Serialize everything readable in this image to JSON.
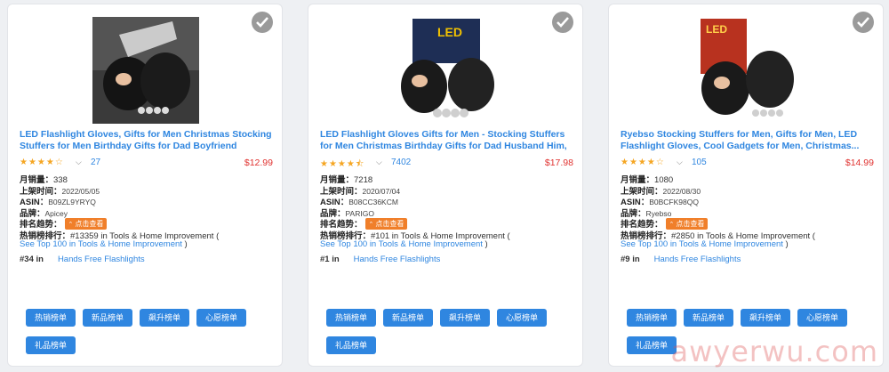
{
  "products": [
    {
      "title": "LED Flashlight Gloves, Gifts for Men Christmas Stocking Stuffers for Men Birthday Gifts for Dad Boyfriend Husban...",
      "stars": "★★★★☆",
      "rating_value": 3.8,
      "review_count": "27",
      "price": "$12.99",
      "monthly_sales_label": "月销量：",
      "monthly_sales": "338",
      "listed_label": "上架时间：",
      "listed_date": "2022/05/05",
      "asin_label": "ASIN：",
      "asin": "B09ZL9YRYQ",
      "brand_label": "品牌：",
      "brand": "Apicey",
      "trend_label": "排名趋势：",
      "trend_button": "点击查看",
      "rank_label": "热销榜排行：",
      "rank_text": "#13359 in   Tools & Home Improvement (",
      "top100_prefix": "See Top 100 in",
      "top100_category": "Tools & Home Improvement",
      "top100_suffix": ")",
      "sub_rank": "#34  in",
      "sub_category": "Hands Free Flashlights"
    },
    {
      "title": "LED Flashlight Gloves Gifts for Men - Stocking Stuffers for Men Christmas Birthday Gifts for Dad Husband Him, Car...",
      "stars": "★★★★⯪",
      "rating_value": 4.5,
      "review_count": "7402",
      "price": "$17.98",
      "monthly_sales_label": "月销量：",
      "monthly_sales": "7218",
      "listed_label": "上架时间：",
      "listed_date": "2020/07/04",
      "asin_label": "ASIN：",
      "asin": "B08CC36KCM",
      "brand_label": "品牌：",
      "brand": "PARIGO",
      "trend_label": "排名趋势：",
      "trend_button": "点击查看",
      "rank_label": "热销榜排行：",
      "rank_text": "#101 in   Tools & Home Improvement (",
      "top100_prefix": "See Top 100 in",
      "top100_category": "Tools & Home Improvement",
      "top100_suffix": ")",
      "sub_rank": "#1  in",
      "sub_category": "Hands Free Flashlights"
    },
    {
      "title": "Ryebso Stocking Stuffers for Men, Gifts for Men, LED Flashlight Gloves, Cool Gadgets for Men, Christmas...",
      "stars": "★★★★☆",
      "rating_value": 4.0,
      "review_count": "105",
      "price": "$14.99",
      "monthly_sales_label": "月销量：",
      "monthly_sales": "1080",
      "listed_label": "上架时间：",
      "listed_date": "2022/08/30",
      "asin_label": "ASIN：",
      "asin": "B0BCFK98QQ",
      "brand_label": "品牌：",
      "brand": "Ryebso",
      "trend_label": "排名趋势：",
      "trend_button": "点击查看",
      "rank_label": "热销榜排行：",
      "rank_text": "#2850 in   Tools & Home Improvement (",
      "top100_prefix": "See Top 100 in",
      "top100_category": "Tools & Home Improvement",
      "top100_suffix": ")",
      "sub_rank": "#9  in",
      "sub_category": "Hands Free Flashlights"
    }
  ],
  "buttons": {
    "best_sellers": "热销榜单",
    "new_releases": "新品榜单",
    "movers": "飙升榜单",
    "wishlist": "心愿榜单",
    "gift": "礼品榜单"
  },
  "watermark": "awyerwu.com",
  "colors": {
    "link": "#2f86e0",
    "price": "#e0312f",
    "star": "#f5a623",
    "trend_button": "#f07f2a",
    "action_button": "#2f86e0"
  }
}
